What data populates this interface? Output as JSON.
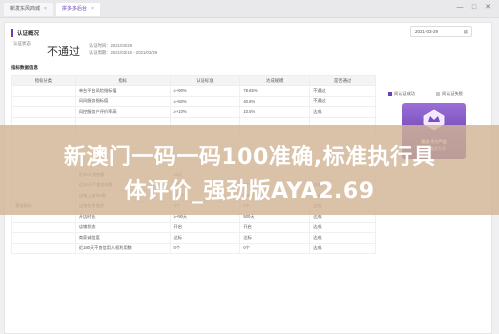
{
  "tabs": [
    {
      "label": "新发东风商城",
      "active": false
    },
    {
      "label": "拼多多后台",
      "active": true
    }
  ],
  "window": {
    "minimize": "—",
    "maximize": "□",
    "close": "✕"
  },
  "section_title": "认证概况",
  "date_filter": {
    "value": "2021-03-29",
    "icon": "calendar-icon"
  },
  "status": {
    "label": "认证状态",
    "value": "不通过",
    "meta1": "认证时间：2021/03/29",
    "meta2": "认证周期：2021/03/16 - 2021/03/29"
  },
  "table_section_title": "指标数据信息",
  "table": {
    "headers": [
      "指标分类",
      "指标",
      "认证标准",
      "达成规模",
      "是否通过"
    ],
    "rows": [
      {
        "cat": "",
        "metric": "单台平台风险指标值",
        "standard": "≥+90%",
        "actual": "78.65%",
        "result": "不通过",
        "fail": true
      },
      {
        "cat": "",
        "metric": "风风服务指标值",
        "standard": "≥+50%",
        "actual": "40.8%",
        "result": "不通过",
        "fail": true
      },
      {
        "cat": "",
        "metric": "风控服务户评价率高",
        "standard": "≥+10%",
        "actual": "10.5%",
        "result": "达成",
        "fail": false
      },
      {
        "cat": "",
        "metric": "",
        "standard": "",
        "actual": "",
        "result": "",
        "fail": false
      },
      {
        "cat": "",
        "metric": "",
        "standard": "",
        "actual": "",
        "result": "",
        "fail": false
      },
      {
        "cat": "",
        "metric": "",
        "standard": "",
        "actual": "",
        "result": "",
        "fail": false
      },
      {
        "cat": "",
        "metric": "",
        "standard": "",
        "actual": "",
        "result": "",
        "fail": false
      },
      {
        "cat": "",
        "metric": "",
        "standard": "",
        "actual": "",
        "result": "",
        "fail": false
      },
      {
        "cat": "",
        "metric": "近30天销售额",
        "standard": "≥1万",
        "actual": "",
        "result": "",
        "fail": false
      },
      {
        "cat": "",
        "metric": "近30天严重违规数",
        "standard": "0个",
        "actual": "0个",
        "result": "达成",
        "fail": false
      },
      {
        "cat": "",
        "metric": "店铺上架sku数",
        "standard": "≥10个",
        "actual": "148个",
        "result": "达成",
        "fail": false
      },
      {
        "cat": "基础指标",
        "metric": "店铺信息描述",
        "standard": "0个",
        "actual": "0个",
        "result": "达成",
        "fail": false
      },
      {
        "cat": "",
        "metric": "开店时长",
        "standard": "≥+90天",
        "actual": "500天",
        "result": "达成",
        "fail": false
      },
      {
        "cat": "",
        "metric": "店铺状态",
        "standard": "开启",
        "actual": "开启",
        "result": "达成",
        "fail": false
      },
      {
        "cat": "",
        "metric": "商家诚信度",
        "standard": "达标",
        "actual": "达标",
        "result": "达成",
        "fail": false
      },
      {
        "cat": "",
        "metric": "近180天不良信用人权利用数",
        "standard": "0个",
        "actual": "0个",
        "result": "达成",
        "fail": false
      }
    ]
  },
  "side": {
    "legend1": "同认证成功",
    "legend2": "同认证失败",
    "promo_line1": "甄选·东方严选",
    "promo_line2": "品质商家专享",
    "colors": {
      "pass": "#6a3fb3",
      "fail": "#c7c7d4"
    }
  },
  "banner": {
    "line1": "新澳门一码一码100准确,标准执行具",
    "line2": "体评价_强劲版AYA2.69"
  }
}
